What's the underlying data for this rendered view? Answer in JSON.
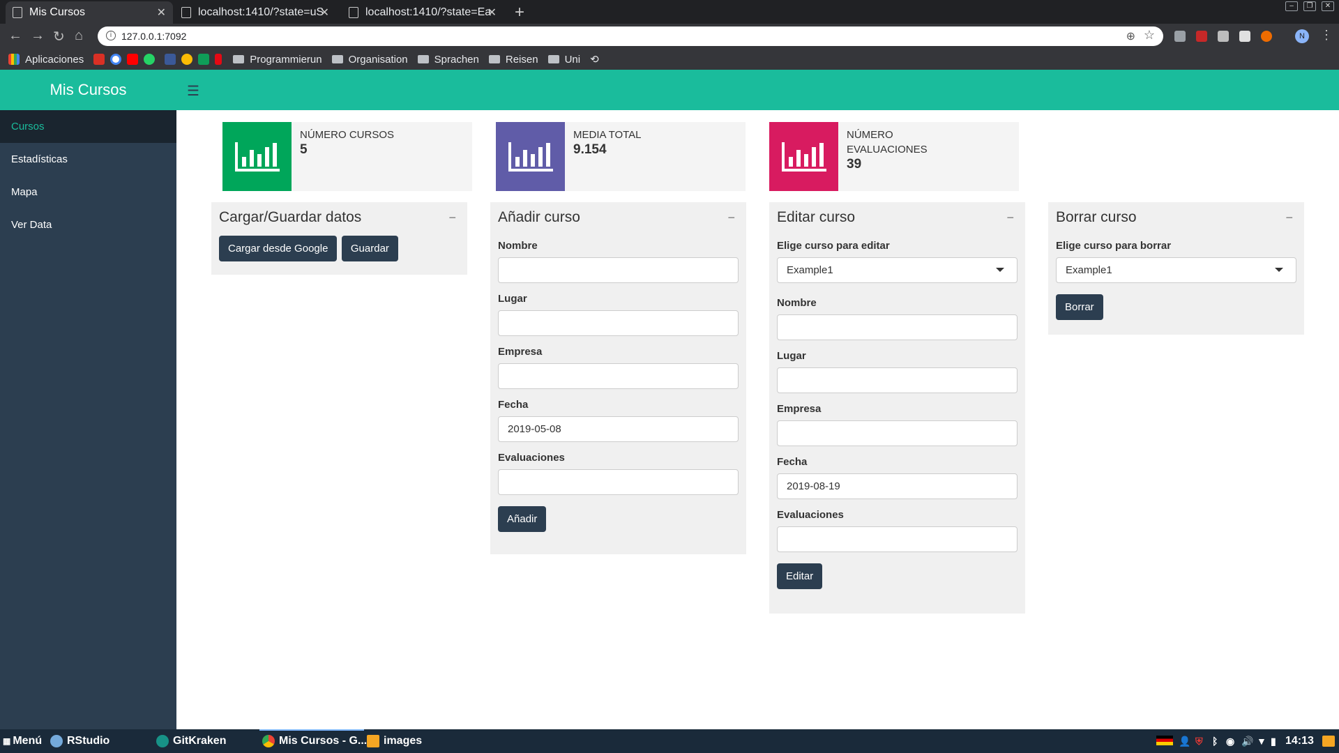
{
  "browser": {
    "tabs": [
      {
        "title": "Mis Cursos",
        "active": true
      },
      {
        "title": "localhost:1410/?state=uS",
        "active": false
      },
      {
        "title": "localhost:1410/?state=Ea",
        "active": false
      }
    ],
    "url": "127.0.0.1:7092",
    "profile_initial": "N",
    "bookmarks": {
      "apps": "Aplicaciones",
      "folders": [
        "Programmierun",
        "Organisation",
        "Sprachen",
        "Reisen",
        "Uni"
      ]
    }
  },
  "app": {
    "brand": "Mis Cursos",
    "sidebar": [
      "Cursos",
      "Estadísticas",
      "Mapa",
      "Ver Data"
    ],
    "infoboxes": [
      {
        "label": "NÚMERO CURSOS",
        "value": "5",
        "color": "#00a65a"
      },
      {
        "label": "MEDIA TOTAL",
        "value": "9.154",
        "color": "#605ca8"
      },
      {
        "label": "NÚMERO EVALUACIONES",
        "value": "39",
        "color": "#d81b60"
      }
    ],
    "load_box": {
      "title": "Cargar/Guardar datos",
      "load_button": "Cargar desde Google",
      "save_button": "Guardar"
    },
    "add_box": {
      "title": "Añadir curso",
      "labels": {
        "nombre": "Nombre",
        "lugar": "Lugar",
        "empresa": "Empresa",
        "fecha": "Fecha",
        "evaluaciones": "Evaluaciones"
      },
      "values": {
        "fecha": "2019-05-08"
      },
      "button": "Añadir"
    },
    "edit_box": {
      "title": "Editar curso",
      "select_label": "Elige curso para editar",
      "select_value": "Example1",
      "labels": {
        "nombre": "Nombre",
        "lugar": "Lugar",
        "empresa": "Empresa",
        "fecha": "Fecha",
        "evaluaciones": "Evaluaciones"
      },
      "values": {
        "fecha": "2019-08-19"
      },
      "button": "Editar"
    },
    "delete_box": {
      "title": "Borrar curso",
      "select_label": "Elige curso para borrar",
      "select_value": "Example1",
      "button": "Borrar"
    }
  },
  "taskbar": {
    "menu": "Menú",
    "apps": [
      "RStudio",
      "GitKraken",
      "Mis Cursos - G...",
      "images"
    ],
    "clock": "14:13"
  }
}
